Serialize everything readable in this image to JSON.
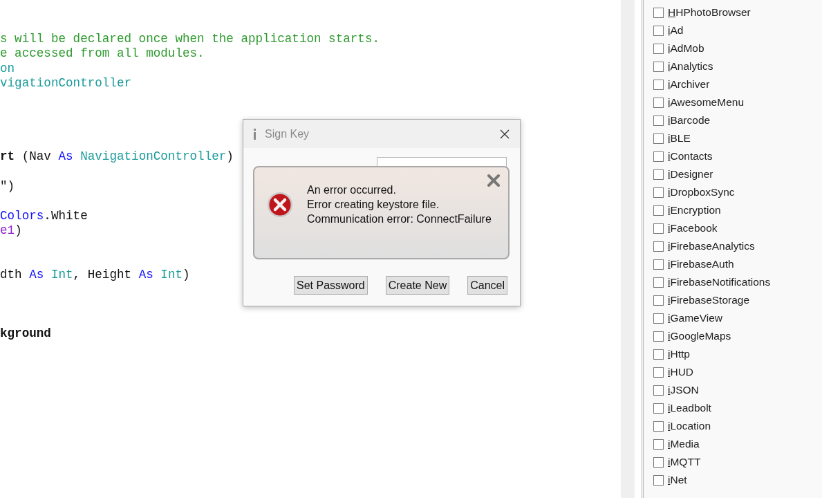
{
  "editor": {
    "lines": [
      {
        "kind": "code",
        "tokens": [
          {
            "kind": "comment",
            "text": "s will be declared once when the application starts."
          }
        ]
      },
      {
        "kind": "code",
        "tokens": [
          {
            "kind": "comment",
            "text": "e accessed from all modules."
          }
        ]
      },
      {
        "kind": "code",
        "tokens": [
          {
            "kind": "type",
            "text": "on"
          }
        ]
      },
      {
        "kind": "code",
        "tokens": [
          {
            "kind": "type",
            "text": "vigationController"
          }
        ]
      },
      {
        "kind": "blank"
      },
      {
        "kind": "blank"
      },
      {
        "kind": "blank"
      },
      {
        "kind": "blank"
      },
      {
        "kind": "code",
        "tokens": [
          {
            "kind": "bold",
            "text": "rt"
          },
          {
            "kind": "plain",
            "text": " (Nav "
          },
          {
            "kind": "keyword",
            "text": "As "
          },
          {
            "kind": "type",
            "text": "NavigationController"
          },
          {
            "kind": "plain",
            "text": ")"
          }
        ]
      },
      {
        "kind": "blank"
      },
      {
        "kind": "code",
        "tokens": [
          {
            "kind": "plain",
            "text": "\")"
          }
        ]
      },
      {
        "kind": "blank"
      },
      {
        "kind": "code",
        "tokens": [
          {
            "kind": "keyword",
            "text": "Colors"
          },
          {
            "kind": "plain",
            "text": ".White"
          }
        ]
      },
      {
        "kind": "code",
        "tokens": [
          {
            "kind": "ident",
            "text": "e1"
          },
          {
            "kind": "plain",
            "text": ")"
          }
        ]
      },
      {
        "kind": "blank"
      },
      {
        "kind": "blank"
      },
      {
        "kind": "code",
        "tokens": [
          {
            "kind": "plain",
            "text": "dth "
          },
          {
            "kind": "keyword",
            "text": "As "
          },
          {
            "kind": "type",
            "text": "Int"
          },
          {
            "kind": "plain",
            "text": ", Height "
          },
          {
            "kind": "keyword",
            "text": "As "
          },
          {
            "kind": "type",
            "text": "Int"
          },
          {
            "kind": "plain",
            "text": ")"
          }
        ]
      },
      {
        "kind": "blank"
      },
      {
        "kind": "blank"
      },
      {
        "kind": "blank"
      },
      {
        "kind": "code",
        "tokens": [
          {
            "kind": "bold",
            "text": "kground"
          }
        ]
      }
    ]
  },
  "dialog": {
    "title": "Sign Key",
    "error": {
      "lines": [
        "An error occurred.",
        "Error creating keystore file.",
        "Communication error: ConnectFailure"
      ]
    },
    "buttons": [
      "Set Password",
      "Create New",
      "Cancel"
    ]
  },
  "libraries": {
    "items": [
      {
        "name": "HHPhotoBrowser",
        "checked": false
      },
      {
        "name": "iAd",
        "checked": false
      },
      {
        "name": "iAdMob",
        "checked": false
      },
      {
        "name": "iAnalytics",
        "checked": false
      },
      {
        "name": "iArchiver",
        "checked": false
      },
      {
        "name": "iAwesomeMenu",
        "checked": false
      },
      {
        "name": "iBarcode",
        "checked": false
      },
      {
        "name": "iBLE",
        "checked": false
      },
      {
        "name": "iContacts",
        "checked": false
      },
      {
        "name": "iDesigner",
        "checked": false
      },
      {
        "name": "iDropboxSync",
        "checked": false
      },
      {
        "name": "iEncryption",
        "checked": false
      },
      {
        "name": "iFacebook",
        "checked": false
      },
      {
        "name": "iFirebaseAnalytics",
        "checked": false
      },
      {
        "name": "iFirebaseAuth",
        "checked": false
      },
      {
        "name": "iFirebaseNotifications",
        "checked": false
      },
      {
        "name": "iFirebaseStorage",
        "checked": false
      },
      {
        "name": "iGameView",
        "checked": false
      },
      {
        "name": "iGoogleMaps",
        "checked": false
      },
      {
        "name": "iHttp",
        "checked": false
      },
      {
        "name": "iHUD",
        "checked": false
      },
      {
        "name": "iJSON",
        "checked": false
      },
      {
        "name": "iLeadbolt",
        "checked": false
      },
      {
        "name": "iLocation",
        "checked": false
      },
      {
        "name": "iMedia",
        "checked": false
      },
      {
        "name": "iMQTT",
        "checked": false
      },
      {
        "name": "iNet",
        "checked": false
      }
    ]
  }
}
